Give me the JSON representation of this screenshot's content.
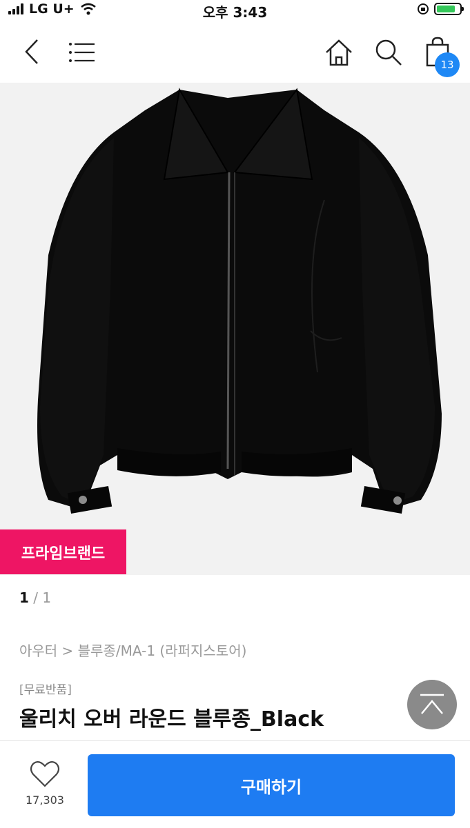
{
  "status_bar": {
    "carrier": "LG U+",
    "time": "오후 3:43"
  },
  "nav": {
    "cart_count": "13",
    "icons": [
      "back-icon",
      "menu-icon",
      "home-icon",
      "search-icon",
      "shopping-bag-icon"
    ]
  },
  "product": {
    "badge": "프라임브랜드",
    "image_index": {
      "current": "1",
      "separator": "/",
      "total": "1"
    },
    "breadcrumb": "아우터 > 블루종/MA-1 (라퍼지스토어)",
    "tag": "[무료반품]",
    "title": "울리치 오버 라운드 블루종_Black"
  },
  "bottom": {
    "like_count": "17,303",
    "buy_label": "구매하기"
  },
  "colors": {
    "accent": "#1e7cf2",
    "badge_pink": "#ee1564",
    "cart_badge": "#1e88f5"
  }
}
